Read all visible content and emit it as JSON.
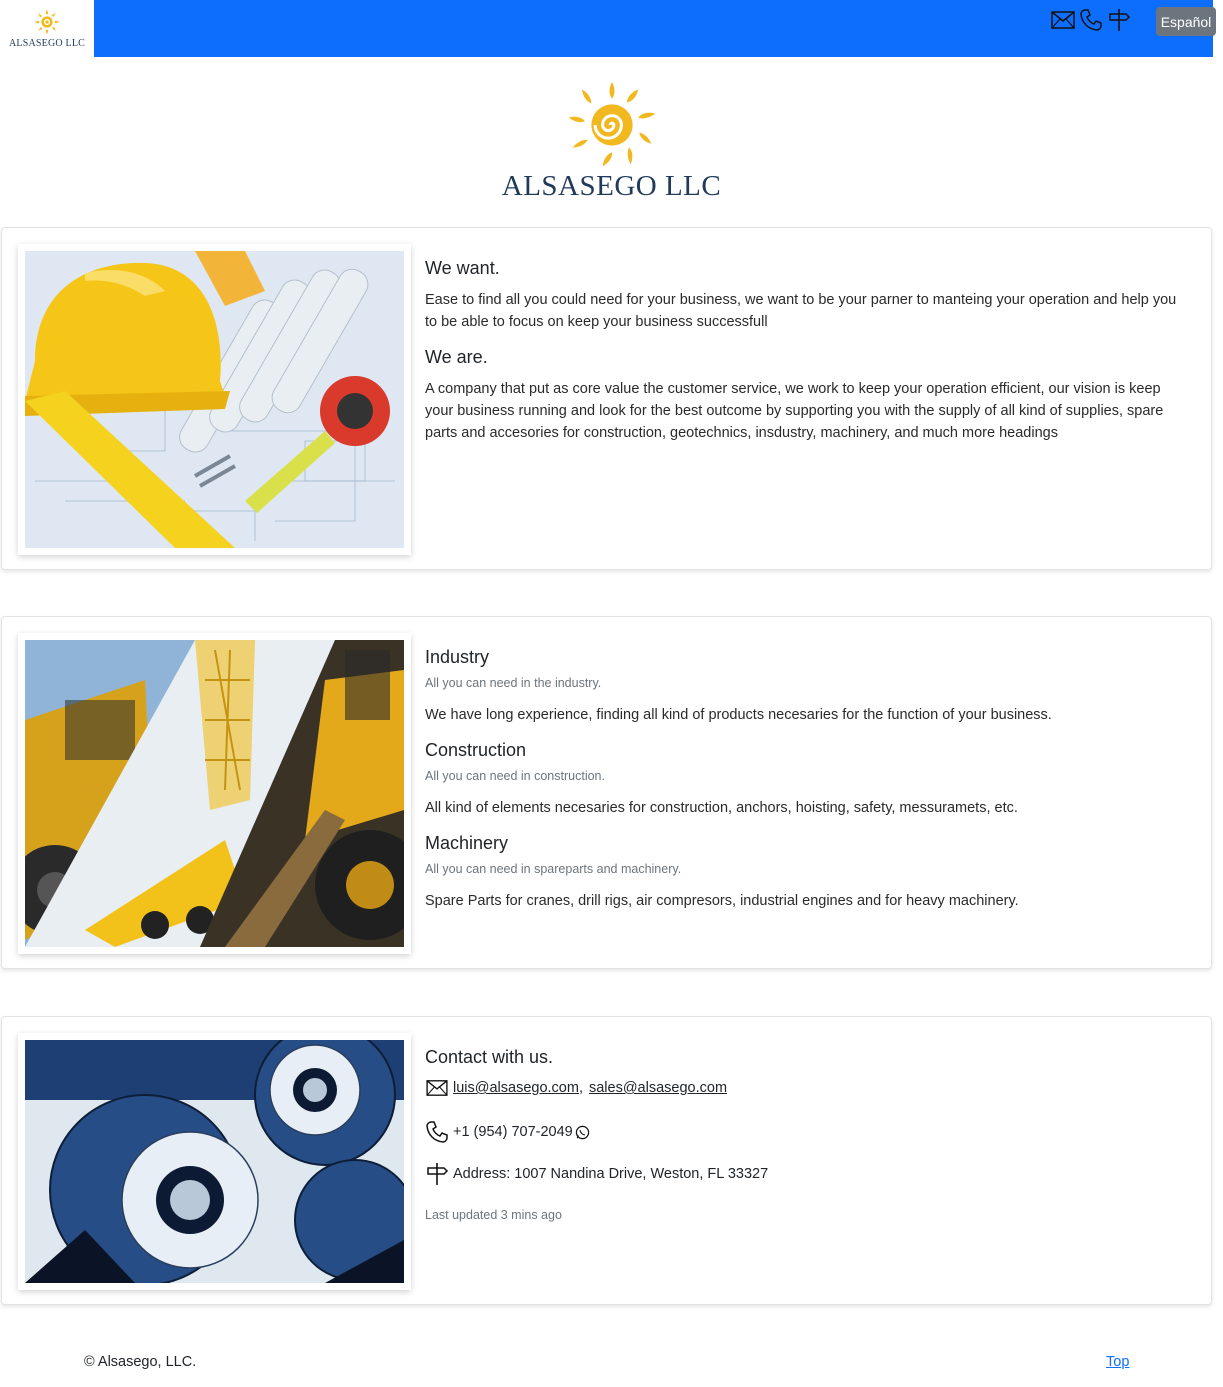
{
  "brand": {
    "name": "ALSASEGO LLC"
  },
  "nav": {
    "icons": [
      "envelope-icon",
      "telephone-icon",
      "signpost-icon"
    ],
    "language_button": "Español"
  },
  "hero": {
    "title": "ALSASEGO LLC"
  },
  "about": {
    "want_title": "We want.",
    "want_text": "Ease to find all you could need for your business, we want to be your parner to manteing your operation and help you to be able to focus on keep your business successfull",
    "are_title": "We are.",
    "are_text": "A company that put as core value the customer service, we work to keep your operation efficient, our vision is keep your business running and look for the best outcome by supporting you with the supply of all kind of supplies, spare parts and accesories for construction, geotechnics, insdustry, machinery, and much more headings"
  },
  "services": [
    {
      "title": "Industry",
      "subtitle": "All you can need in the industry.",
      "text": "We have long experience, finding all kind of products necesaries for the function of your business."
    },
    {
      "title": "Construction",
      "subtitle": "All you can need in construction.",
      "text": "All kind of elements necesaries for construction, anchors, hoisting, safety, messuramets, etc."
    },
    {
      "title": "Machinery",
      "subtitle": "All you can need in spareparts and machinery.",
      "text": "Spare Parts for cranes, drill rigs, air compresors, industrial engines and for heavy machinery."
    }
  ],
  "contact": {
    "title": "Contact with us.",
    "email_1": "luis@alsasego.com",
    "email_sep": ",",
    "email_2": "sales@alsasego.com",
    "phone": "+1 (954) 707-2049",
    "address": "Address: 1007 Nandina Drive, Weston, FL 33327",
    "updated": "Last updated 3 mins ago"
  },
  "footer": {
    "copyright": "© Alsasego, LLC.",
    "top_link": "Top"
  },
  "colors": {
    "navbar": "#0d6efd",
    "logo_sun": "#f2b820",
    "logo_text": "#1f3a5a",
    "button_secondary": "#6c757d"
  }
}
